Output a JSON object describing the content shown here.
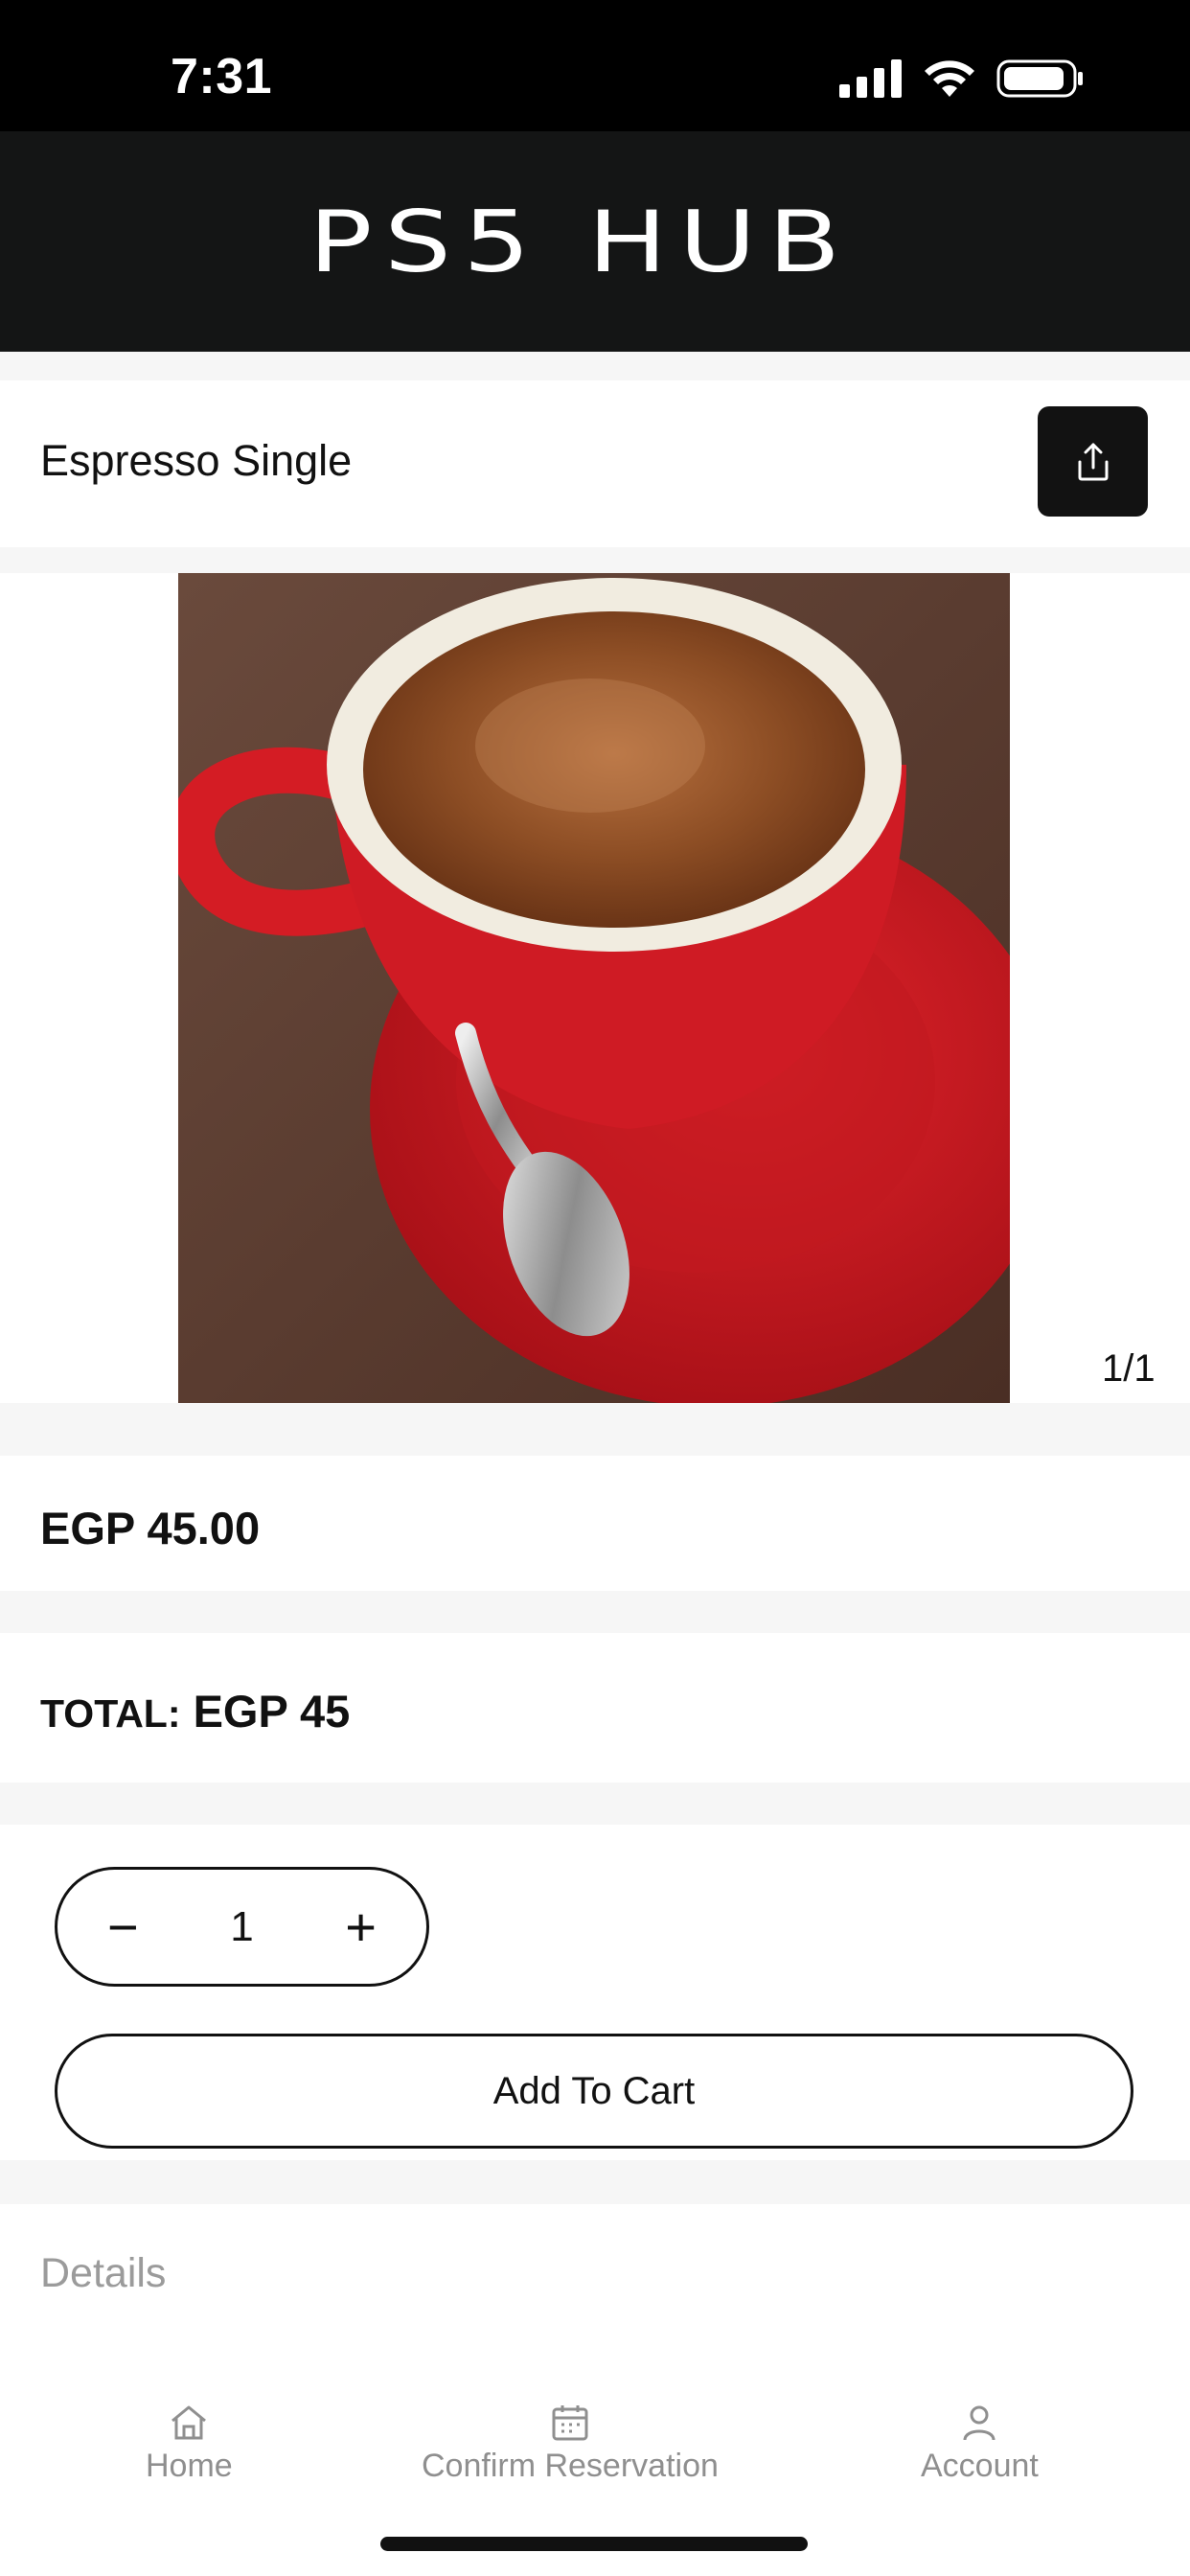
{
  "status_bar": {
    "time": "7:31"
  },
  "brand": {
    "logo_text": "PS5 HUB"
  },
  "product": {
    "title": "Espresso Single",
    "image_alt": "Espresso in red cup",
    "image_counter": "1/1",
    "price": "EGP 45.00"
  },
  "total": {
    "label": "TOTAL:",
    "value": "EGP 45"
  },
  "quantity": {
    "minus": "−",
    "value": "1",
    "plus": "+"
  },
  "cart": {
    "add_label": "Add To Cart"
  },
  "details": {
    "label": "Details"
  },
  "nav": {
    "items": [
      {
        "label": "Home",
        "icon": "home-icon"
      },
      {
        "label": "Confirm Reservation",
        "icon": "calendar-icon"
      },
      {
        "label": "Account",
        "icon": "user-icon"
      }
    ]
  },
  "colors": {
    "header_bg": "#141515",
    "accent": "#121212",
    "nav_inactive": "#8f8f8f"
  }
}
